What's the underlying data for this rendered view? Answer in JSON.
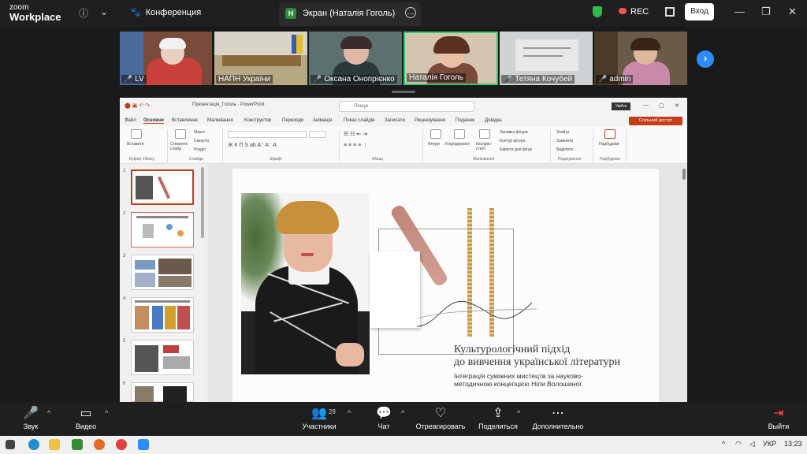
{
  "zoom": {
    "logo_line1": "zoom",
    "logo_line2": "Workplace",
    "conference_label": "Конференция",
    "share_tab_title": "Экран (Наталія Гоголь)",
    "rec_label": "REC",
    "signin_label": "Вход",
    "participant_count": "28"
  },
  "participants": [
    {
      "name": "LV",
      "bg": "#8a6a5a",
      "muted": true
    },
    {
      "name": "НАПН України",
      "bg": "#b0a07a",
      "muted": false
    },
    {
      "name": "Оксана Онопрієнко",
      "bg": "#6d7a7a",
      "muted": true
    },
    {
      "name": "Наталія Гоголь",
      "bg": "#d9c8b8",
      "muted": false,
      "active": true
    },
    {
      "name": "Тетяна Кочубей",
      "bg": "#cfd2d4",
      "muted": true
    },
    {
      "name": "admin",
      "bg": "#7a6a58",
      "muted": true
    }
  ],
  "ppt": {
    "doc_title": "Презентація_Гоголь",
    "app_name": "PowerPoint",
    "search_placeholder": "Пошук",
    "signin": "Увійти",
    "share_btn": "Спільний доступ",
    "tabs": [
      "Файл",
      "Основне",
      "Вставлення",
      "Малювання",
      "Конструктор",
      "Переходи",
      "Анімація",
      "Показ слайдів",
      "Записати",
      "Рецензування",
      "Подання",
      "Довідка"
    ],
    "ribbon": {
      "paste": "Вставити",
      "clipboard_group": "Буфер обміну",
      "new_slide": "Створити слайд",
      "layout": "Макет",
      "reset": "Скинути",
      "section": "Розділ",
      "slides_group": "Слайди",
      "font_group": "Шрифт",
      "paragraph_group": "Абзац",
      "shapes": "Фігури",
      "arrange": "Упорядкувати",
      "quick_styles": "Експрес-стилі",
      "shape_fill": "Заливка фігури",
      "shape_outline": "Контур фігури",
      "shape_effects": "Ефекти для фігур",
      "drawing_group": "Малювання",
      "find": "Знайти",
      "replace": "Замінити",
      "select": "Виділити",
      "editing_group": "Редагування",
      "addins": "Надбудови",
      "addins_group": "Надбудови"
    },
    "thumb_numbers": [
      "1",
      "2",
      "3",
      "4",
      "5",
      "6"
    ],
    "slide": {
      "title_line1": "Культурологічний підхід",
      "title_line2": "до вивчення української літератури",
      "subtitle_line1": "Інтеграція суміжних мистецтв за науково-",
      "subtitle_line2": "методичною концепцією Ніли Волошиної"
    }
  },
  "toolbar": {
    "audio": "Звук",
    "video": "Видео",
    "participants": "Участники",
    "chat": "Чат",
    "react": "Отреагировать",
    "share": "Поделиться",
    "more": "Дополнительно",
    "leave": "Выйти"
  },
  "taskbar": {
    "lang": "УКР",
    "time": "13:23"
  }
}
